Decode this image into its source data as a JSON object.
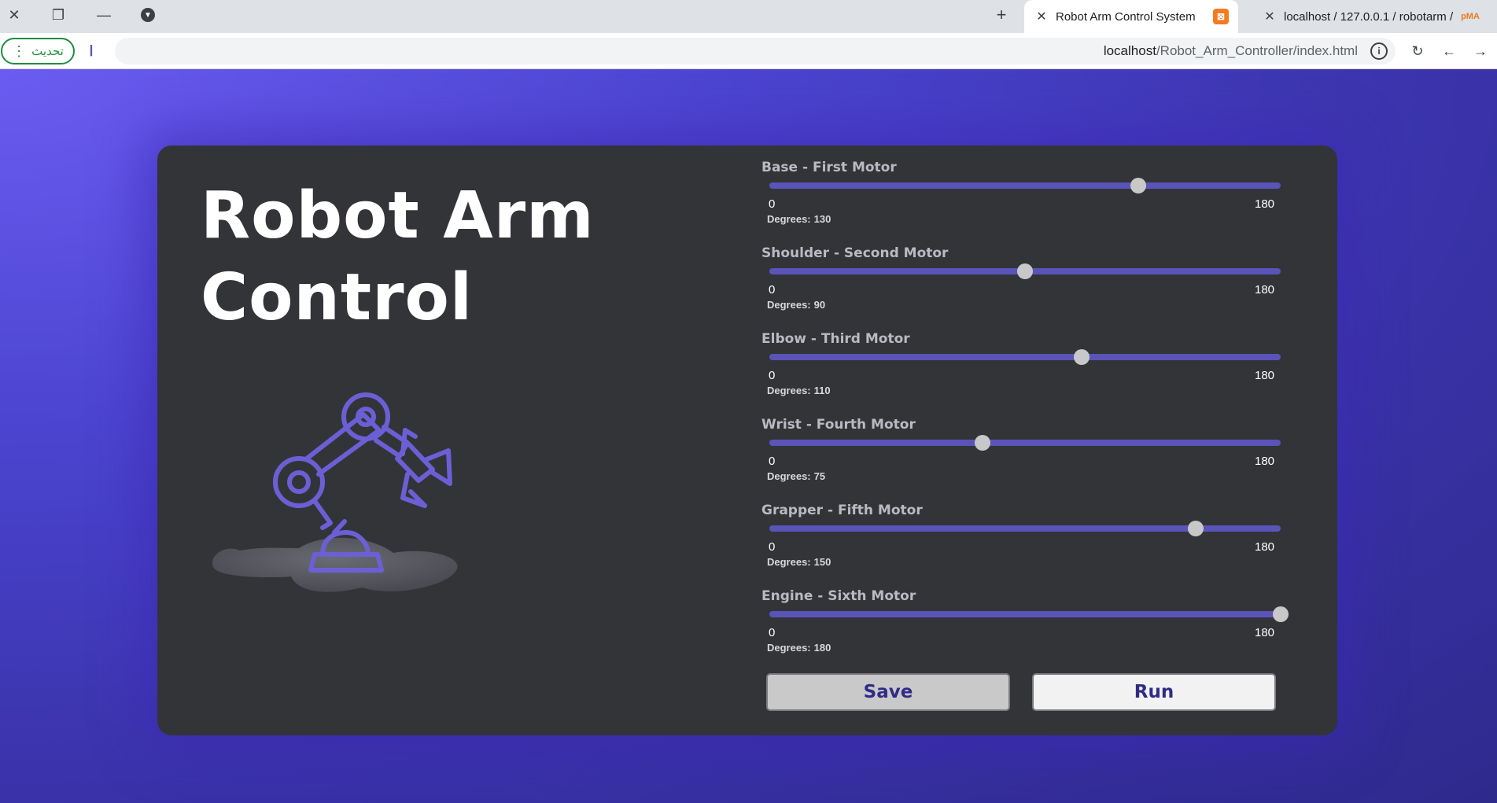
{
  "browser": {
    "tabs": [
      {
        "title": "Robot Arm Control System",
        "active": true
      },
      {
        "title": "localhost / 127.0.0.1 / robotarm /",
        "active": false
      }
    ],
    "update_button": "تحديث",
    "url_host": "localhost",
    "url_path": "/Robot_Arm_Controller/index.html"
  },
  "app": {
    "title_line1": "Robot Arm",
    "title_line2": "Control",
    "illustration_icon": "robot-arm-icon",
    "accent_color": "#5a54b8"
  },
  "slider_range": {
    "min": 0,
    "max": 180,
    "min_label": "0",
    "max_label": "180"
  },
  "degrees_prefix": "Degrees:",
  "motors": [
    {
      "label": "Base - First Motor",
      "value": 130
    },
    {
      "label": "Shoulder - Second Motor",
      "value": 90
    },
    {
      "label": "Elbow - Third Motor",
      "value": 110
    },
    {
      "label": "Wrist - Fourth Motor",
      "value": 75
    },
    {
      "label": "Grapper - Fifth Motor",
      "value": 150
    },
    {
      "label": "Engine - Sixth Motor",
      "value": 180
    }
  ],
  "buttons": {
    "save": "Save",
    "run": "Run"
  }
}
